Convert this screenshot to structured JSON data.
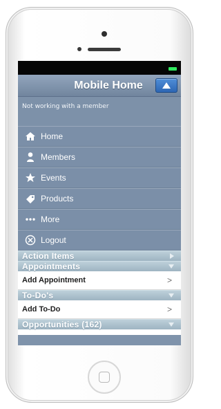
{
  "header": {
    "title": "Mobile Home"
  },
  "status_text": "Not working with a member",
  "menu": {
    "items": [
      {
        "label": "Home",
        "icon": "home-icon"
      },
      {
        "label": "Members",
        "icon": "user-icon"
      },
      {
        "label": "Events",
        "icon": "star-icon"
      },
      {
        "label": "Products",
        "icon": "tag-icon"
      },
      {
        "label": "More",
        "icon": "more-icon"
      },
      {
        "label": "Logout",
        "icon": "logout-icon"
      }
    ]
  },
  "sections": {
    "action_items": {
      "label": "Action Items"
    },
    "appointments": {
      "label": "Appointments"
    },
    "add_appointment": {
      "label": "Add Appointment",
      "arrow": ">"
    },
    "todos": {
      "label": "To-Do's"
    },
    "add_todo": {
      "label": "Add To-Do",
      "arrow": ">"
    },
    "opportunities": {
      "label": "Opportunities (162)"
    }
  },
  "colors": {
    "screen": "#7f93ab",
    "header_button": "#2d66b3",
    "battery": "#30e85e"
  }
}
